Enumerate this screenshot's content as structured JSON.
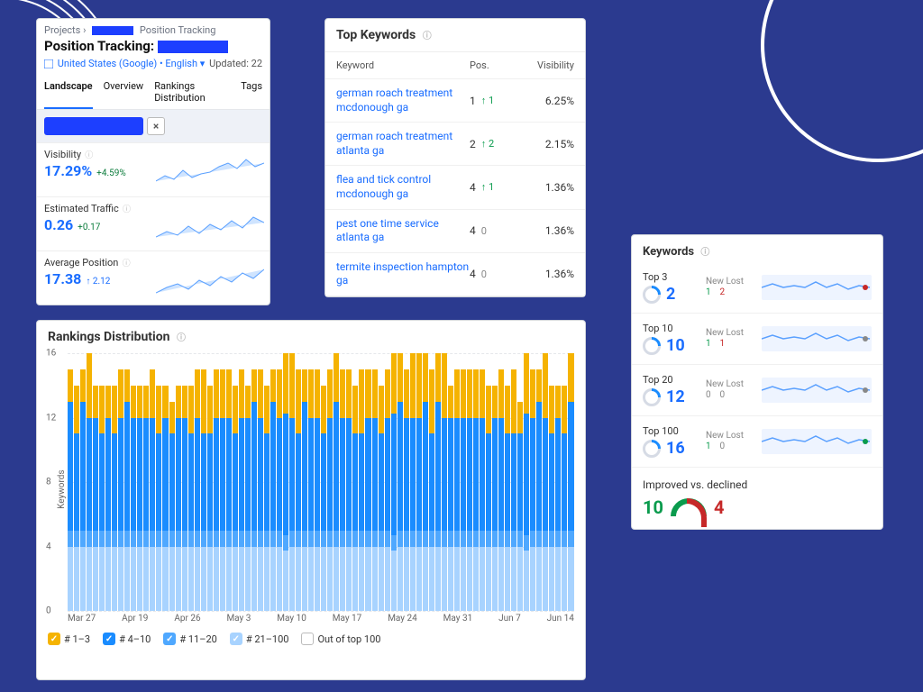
{
  "breadcrumbs": {
    "projects": "Projects",
    "page": "Position Tracking"
  },
  "position_tracking": {
    "title": "Position Tracking:",
    "locale": "United States (Google) • English",
    "updated": "Updated: 22",
    "tabs": [
      "Landscape",
      "Overview",
      "Rankings Distribution",
      "Tags"
    ],
    "metrics": [
      {
        "label": "Visibility",
        "value": "17.29%",
        "delta": "+4.59%"
      },
      {
        "label": "Estimated Traffic",
        "value": "0.26",
        "delta": "+0.17"
      },
      {
        "label": "Average Position",
        "value": "17.38",
        "delta": "↑ 2.12"
      }
    ]
  },
  "top_keywords": {
    "title": "Top Keywords",
    "cols": {
      "kw": "Keyword",
      "pos": "Pos.",
      "vis": "Visibility"
    },
    "rows": [
      {
        "kw": "german roach treatment mcdonough ga",
        "pos": "1",
        "chg": "↑ 1",
        "vis": "6.25%"
      },
      {
        "kw": "german roach treatment atlanta ga",
        "pos": "2",
        "chg": "↑ 2",
        "vis": "2.15%"
      },
      {
        "kw": "flea and tick control mcdonough ga",
        "pos": "4",
        "chg": "↑ 1",
        "vis": "1.36%"
      },
      {
        "kw": "pest one time service atlanta ga",
        "pos": "4",
        "chg": "0",
        "vis": "1.36%"
      },
      {
        "kw": "termite inspection hampton ga",
        "pos": "4",
        "chg": "0",
        "vis": "1.36%"
      }
    ]
  },
  "rankings_distribution": {
    "title": "Rankings Distribution",
    "ylabel": "Keywords",
    "yticks": [
      "0",
      "4",
      "8",
      "12",
      "16"
    ],
    "xticks": [
      "Mar 27",
      "Apr 19",
      "Apr 26",
      "May 3",
      "May 10",
      "May 17",
      "May 24",
      "May 31",
      "Jun 7",
      "Jun 14"
    ],
    "legend": [
      "# 1–3",
      "# 4–10",
      "# 11–20",
      "# 21–100",
      "Out of top 100"
    ]
  },
  "keywords_summary": {
    "title": "Keywords",
    "rows": [
      {
        "label": "Top 3",
        "n": "2",
        "new": "1",
        "lost": "2",
        "dot": "#c62828"
      },
      {
        "label": "Top 10",
        "n": "10",
        "new": "1",
        "lost": "1",
        "dot": "#888"
      },
      {
        "label": "Top 20",
        "n": "12",
        "new": "0",
        "lost": "0",
        "dot": "#888"
      },
      {
        "label": "Top 100",
        "n": "16",
        "new": "1",
        "lost": "0",
        "dot": "#0a9b4d"
      }
    ],
    "improved_label": "Improved vs. declined",
    "improved": "10",
    "declined": "4"
  },
  "chart_data": {
    "type": "bar",
    "stacked": true,
    "ylabel": "Keywords",
    "ylim": [
      0,
      16
    ],
    "legend": [
      "# 1–3",
      "# 4–10",
      "# 11–20",
      "# 21–100"
    ],
    "x_start": "Mar 27",
    "x_end": "Jun 14",
    "series": [
      {
        "name": "# 21–100",
        "approx_constant": 4
      },
      {
        "name": "# 11–20",
        "approx_constant": 1
      },
      {
        "name": "# 4–10",
        "approx_range": [
          6,
          8
        ]
      },
      {
        "name": "# 1–3",
        "approx_range": [
          2,
          4
        ]
      }
    ],
    "note": "Daily stacked bars; totals hover around 14–16 keywords per day"
  }
}
